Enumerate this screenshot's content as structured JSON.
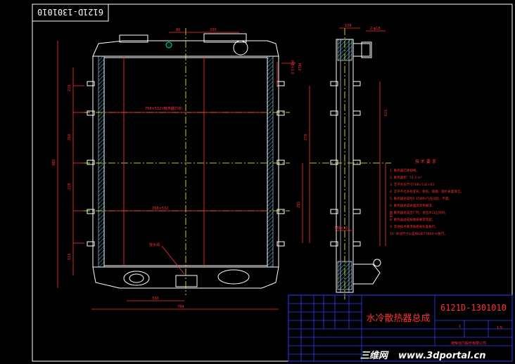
{
  "drawing_number": "6121D-1301010",
  "title_block": {
    "title": "水冷散热器总成",
    "code": "6121D-1301010",
    "scale": "1:5",
    "sheet": "1",
    "company": "潍柴动力股份有限公司"
  },
  "tech_requirements": {
    "heading": "技 术 要 求",
    "items": [
      "1. 散热器芯体规格。",
      "2. 散热面积：51.2 m²",
      "3. 芯子外形尺寸768×532×63",
      "4. 芯子不允许有变形、损伤，管路、翅片表面清洁。",
      "5. 散热器总成经0.15MPa气压试验，不漏。",
      "6. 散热器总成表面涂黑色磁漆。",
      "7. 散热器总成出厂时，进出水口应封闭。",
      "8. 散热器总成按图纸要求装配。",
      "9. 其他技术要求按相关标准执行。",
      "10. 未注尺寸公差按GB/T1804-m执行。"
    ]
  },
  "annotations": {
    "core_label": "768×532 (散热器芯体)",
    "core_label2": "768×532",
    "side_note1": "M8×1.0",
    "side_note2": "M10",
    "mid_label": "M6×12",
    "bottom_label": "放水阀"
  },
  "dimensions": {
    "top_a": "80",
    "top_b": "330",
    "overall_width": "784",
    "bottom_a": "330",
    "left_total": "980",
    "left_1": "226",
    "left_2": "266",
    "left_3": "226",
    "left_4": "116",
    "side_top": "108",
    "side_top2": "2-φ18",
    "side_right": "570",
    "side_mid": "276",
    "side_mid2": "291",
    "side_low": "316"
  },
  "watermark": {
    "brand": "三维网",
    "url": "www.3dportal.cn"
  },
  "colors": {
    "background": "#000000",
    "outline": "#ffffff",
    "dimension": "#ff3333",
    "center": "#ffff33",
    "hatch": "#3ad0ff",
    "table": "#2d3cff",
    "title_text": "#ff3333",
    "label_text": "#ff3333",
    "accent": "#00ff66"
  }
}
